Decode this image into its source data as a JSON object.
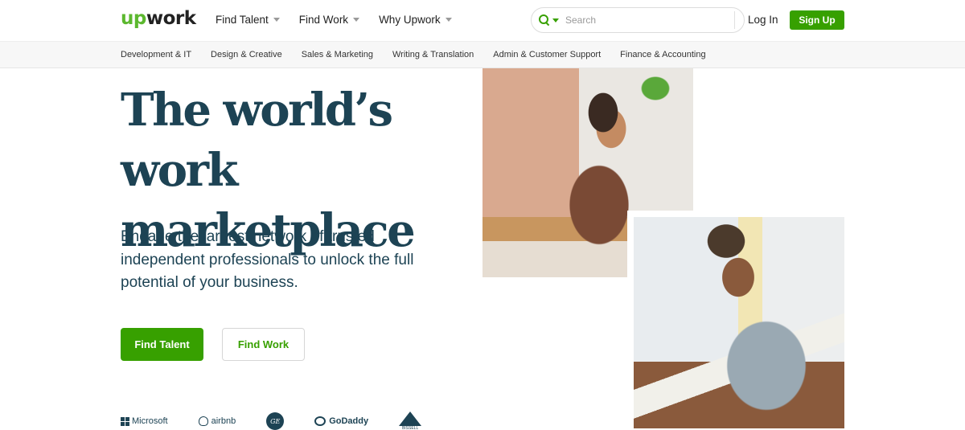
{
  "header": {
    "logo": {
      "part1": "up",
      "part2": "work"
    },
    "nav": [
      {
        "label": "Find Talent"
      },
      {
        "label": "Find Work"
      },
      {
        "label": "Why Upwork"
      }
    ],
    "search": {
      "placeholder": "Search",
      "icon": "search-icon"
    },
    "login_label": "Log In",
    "signup_label": "Sign Up"
  },
  "categories": [
    "Development & IT",
    "Design & Creative",
    "Sales & Marketing",
    "Writing & Translation",
    "Admin & Customer Support",
    "Finance & Accounting"
  ],
  "hero": {
    "title": "The world’s work marketplace",
    "subtitle": "Engage the largest network of trusted independent professionals to unlock the full potential of your business.",
    "find_talent_label": "Find Talent",
    "find_work_label": "Find Work"
  },
  "trusted_by": {
    "microsoft": "Microsoft",
    "airbnb": "airbnb",
    "ge": "GE",
    "godaddy": "GoDaddy",
    "bissell": "BISSELL"
  },
  "photos": {
    "photo1": "woman-working-at-table",
    "photo2": "man-writing-in-notebook"
  },
  "colors": {
    "brand_green": "#37a000",
    "heading_navy": "#1d4354"
  }
}
